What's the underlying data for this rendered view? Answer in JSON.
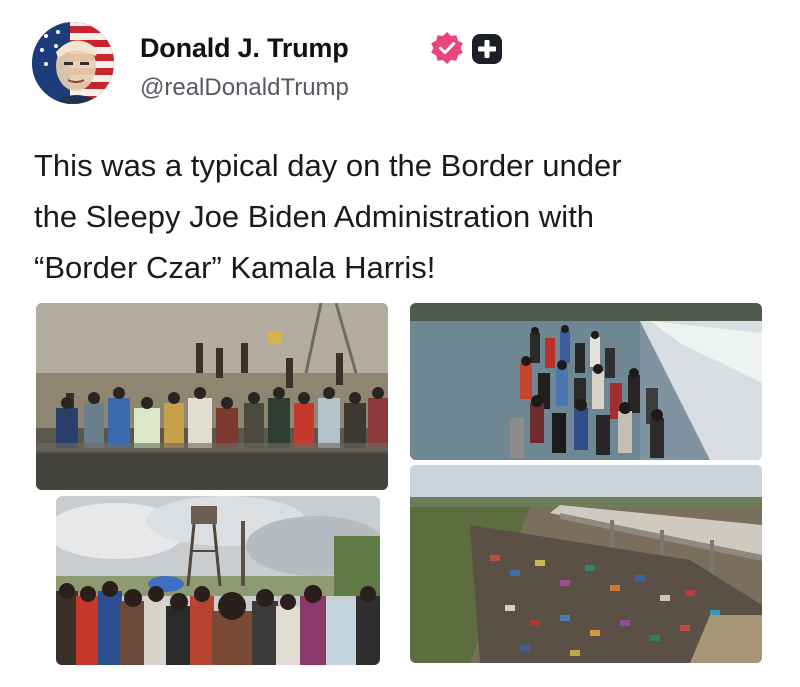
{
  "post": {
    "author": {
      "display_name": "Donald J. Trump",
      "handle": "@realDonaldTrump",
      "avatar_icon": "flag-portrait-avatar",
      "verified_icon": "verified-badge-icon",
      "subscription_icon": "plus-badge-icon"
    },
    "text_lines": [
      "This was a typical day on the Border under",
      "the Sleepy Joe Biden Administration with",
      "“Border Czar” Kamala Harris!"
    ],
    "media_count": 4
  },
  "colors": {
    "verified_badge": "#e8467b",
    "plus_badge": "#1c1f26",
    "handle_text": "#555a61",
    "body_text": "#1a1a1a"
  }
}
